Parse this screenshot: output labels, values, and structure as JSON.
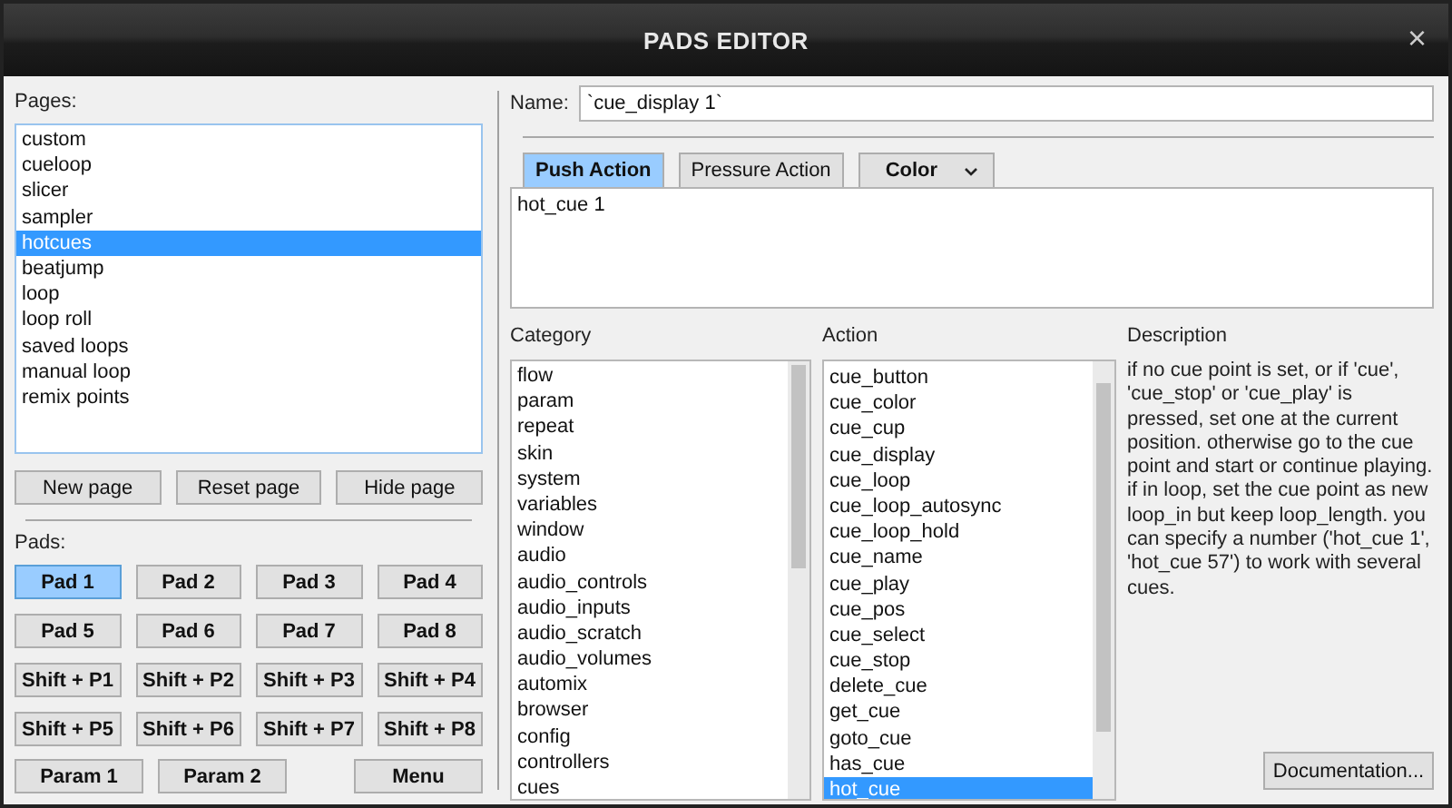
{
  "window": {
    "title": "PADS EDITOR",
    "close": "×"
  },
  "pages": {
    "label": "Pages:",
    "items": [
      {
        "label": "custom",
        "selected": false
      },
      {
        "label": "cueloop",
        "selected": false
      },
      {
        "label": "slicer",
        "selected": false
      },
      {
        "label": "sampler",
        "selected": false
      },
      {
        "label": "hotcues",
        "selected": true
      },
      {
        "label": "beatjump",
        "selected": false
      },
      {
        "label": "loop",
        "selected": false
      },
      {
        "label": "loop roll",
        "selected": false
      },
      {
        "label": "saved loops",
        "selected": false
      },
      {
        "label": "manual loop",
        "selected": false
      },
      {
        "label": "remix points",
        "selected": false
      }
    ],
    "buttons": [
      "New page",
      "Reset page",
      "Hide page"
    ]
  },
  "pads": {
    "label": "Pads:",
    "items": [
      {
        "label": "Pad 1",
        "selected": true
      },
      {
        "label": "Pad 2",
        "selected": false
      },
      {
        "label": "Pad 3",
        "selected": false
      },
      {
        "label": "Pad 4",
        "selected": false
      },
      {
        "label": "Pad 5",
        "selected": false
      },
      {
        "label": "Pad 6",
        "selected": false
      },
      {
        "label": "Pad 7",
        "selected": false
      },
      {
        "label": "Pad 8",
        "selected": false
      },
      {
        "label": "Shift + P1",
        "selected": false
      },
      {
        "label": "Shift + P2",
        "selected": false
      },
      {
        "label": "Shift + P3",
        "selected": false
      },
      {
        "label": "Shift + P4",
        "selected": false
      },
      {
        "label": "Shift + P5",
        "selected": false
      },
      {
        "label": "Shift + P6",
        "selected": false
      },
      {
        "label": "Shift + P7",
        "selected": false
      },
      {
        "label": "Shift + P8",
        "selected": false
      }
    ],
    "bottom_buttons": [
      "Param 1",
      "Param 2",
      "Menu"
    ]
  },
  "name": {
    "label": "Name:",
    "value": "`cue_display 1`"
  },
  "tabs": [
    {
      "label": "Push Action",
      "selected": true,
      "kind": "tab"
    },
    {
      "label": "Pressure Action",
      "selected": false,
      "kind": "tab"
    },
    {
      "label": "Color",
      "selected": false,
      "kind": "dropdown"
    }
  ],
  "script": "hot_cue 1",
  "category": {
    "label": "Category",
    "items": [
      {
        "label": "flow",
        "selected": false
      },
      {
        "label": "param",
        "selected": false
      },
      {
        "label": "repeat",
        "selected": false
      },
      {
        "label": "skin",
        "selected": false
      },
      {
        "label": "system",
        "selected": false
      },
      {
        "label": "variables",
        "selected": false
      },
      {
        "label": "window",
        "selected": false
      },
      {
        "label": "audio",
        "selected": false
      },
      {
        "label": "audio_controls",
        "selected": false
      },
      {
        "label": "audio_inputs",
        "selected": false
      },
      {
        "label": "audio_scratch",
        "selected": false
      },
      {
        "label": "audio_volumes",
        "selected": false
      },
      {
        "label": "automix",
        "selected": false
      },
      {
        "label": "browser",
        "selected": false
      },
      {
        "label": "config",
        "selected": false
      },
      {
        "label": "controllers",
        "selected": false
      },
      {
        "label": "cues",
        "selected": false
      }
    ]
  },
  "action": {
    "label": "Action",
    "items": [
      {
        "label": "cue_button",
        "selected": false
      },
      {
        "label": "cue_color",
        "selected": false
      },
      {
        "label": "cue_cup",
        "selected": false
      },
      {
        "label": "cue_display",
        "selected": false
      },
      {
        "label": "cue_loop",
        "selected": false
      },
      {
        "label": "cue_loop_autosync",
        "selected": false
      },
      {
        "label": "cue_loop_hold",
        "selected": false
      },
      {
        "label": "cue_name",
        "selected": false
      },
      {
        "label": "cue_play",
        "selected": false
      },
      {
        "label": "cue_pos",
        "selected": false
      },
      {
        "label": "cue_select",
        "selected": false
      },
      {
        "label": "cue_stop",
        "selected": false
      },
      {
        "label": "delete_cue",
        "selected": false
      },
      {
        "label": "get_cue",
        "selected": false
      },
      {
        "label": "goto_cue",
        "selected": false
      },
      {
        "label": "has_cue",
        "selected": false
      },
      {
        "label": "hot_cue",
        "selected": true
      }
    ]
  },
  "description": {
    "label": "Description",
    "text": "if no cue point is set, or if 'cue', 'cue_stop' or 'cue_play' is pressed, set one at the current position. otherwise go to the cue point and start or continue playing. if in loop, set the cue point as new loop_in but keep loop_length. you can specify a number ('hot_cue 1', 'hot_cue 57') to work with several cues.",
    "button": "Documentation..."
  }
}
